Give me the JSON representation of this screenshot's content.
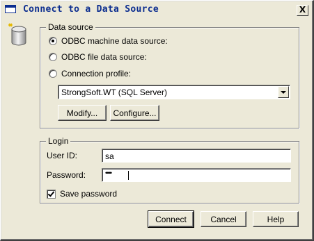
{
  "window": {
    "title": "Connect to a Data Source",
    "close_glyph": "X",
    "title_icon": "window-icon",
    "app_icon": "database-icon"
  },
  "data_source": {
    "group_label": "Data source",
    "options": [
      {
        "label": "ODBC machine data source:",
        "selected": true
      },
      {
        "label": "ODBC file data source:",
        "selected": false
      },
      {
        "label": "Connection profile:",
        "selected": false
      }
    ],
    "profile_value": "StrongSoft.WT (SQL Server)",
    "modify_label": "Modify...",
    "configure_label": "Configure..."
  },
  "login": {
    "group_label": "Login",
    "user_id_label": "User ID:",
    "user_id_value": "sa",
    "password_label": "Password:",
    "password_mask": "•••••••",
    "save_password_label": "Save password",
    "save_password_checked": true
  },
  "footer": {
    "connect_label": "Connect",
    "cancel_label": "Cancel",
    "help_label": "Help"
  },
  "colors": {
    "dialog_face": "#ece9d8",
    "title_text": "#0b2d8f"
  }
}
